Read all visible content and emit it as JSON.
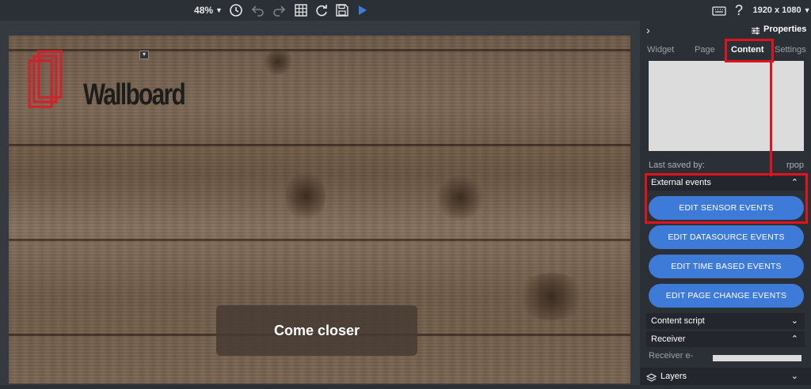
{
  "toolbar": {
    "zoom": "48%",
    "resolution": "1920 x 1080",
    "icons": [
      "history-icon",
      "undo-icon",
      "redo-icon",
      "grid-icon",
      "refresh-icon",
      "save-icon",
      "play-icon",
      "keyboard-icon",
      "help-icon"
    ]
  },
  "canvas": {
    "logo_text": "Wallboard",
    "overlay_text": "Come closer"
  },
  "panel": {
    "title": "Properties",
    "tabs": [
      "Widget",
      "Page",
      "Content",
      "Settings"
    ],
    "active_tab": "Content",
    "last_saved_label": "Last saved by:",
    "last_saved_user": "rpop",
    "external_events": {
      "title": "External events",
      "buttons": [
        "EDIT SENSOR EVENTS",
        "EDIT DATASOURCE EVENTS",
        "EDIT TIME BASED EVENTS",
        "EDIT PAGE CHANGE EVENTS"
      ]
    },
    "content_script": "Content script",
    "receiver": {
      "title": "Receiver",
      "email_label": "Receiver e-"
    },
    "layers": "Layers"
  },
  "colors": {
    "accent_button": "#3e7bd8",
    "highlight": "#e0121b",
    "panel_bg": "#2b3037"
  }
}
